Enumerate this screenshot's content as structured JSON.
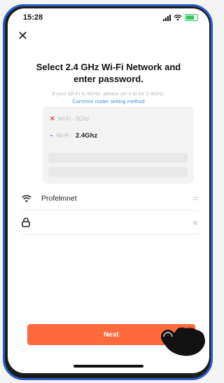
{
  "status_bar": {
    "time": "15:28"
  },
  "close_label": "✕",
  "title_line1": "Select 2.4 GHz Wi-Fi Network and",
  "title_line2": "enter password.",
  "hint_line1": "If your Wi-Fi is 5GHz, please set it to be 2.4GHz.",
  "hint_link": "Common router setting method",
  "example": {
    "wrong_mark": "✕",
    "wrong_label": "Wi-Fi - 5Ghz",
    "right_mark": "⌁",
    "right_prefix": "Wi-Fi -",
    "right_band": "2.4Ghz"
  },
  "wifi_field": {
    "icon": "wifi-icon",
    "value": "Profelmnet"
  },
  "password_field": {
    "icon": "lock-icon",
    "value": ""
  },
  "next_label": "Next",
  "colors": {
    "accent": "#ff6a3d",
    "link": "#4a8fe2",
    "frame": "#2a5dc8"
  }
}
